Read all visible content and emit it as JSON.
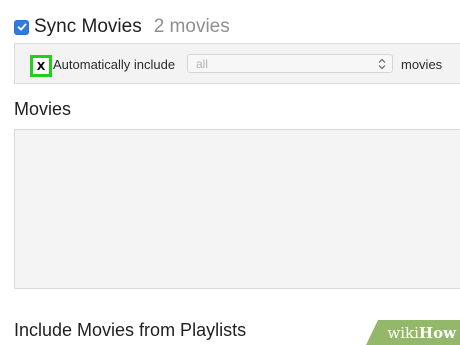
{
  "sync": {
    "label": "Sync Movies",
    "count": "2 movies",
    "checked": true
  },
  "auto_include": {
    "label": "Automatically include",
    "checkbox_mark": "X",
    "select_value": "all",
    "suffix": "movies"
  },
  "movies_section": {
    "title": "Movies"
  },
  "playlists_section": {
    "title": "Include Movies from Playlists"
  },
  "watermark": {
    "part1": "wiki",
    "part2": "How"
  },
  "colors": {
    "checkbox_blue": "#2f7ce0",
    "highlight_green": "#1fd11a",
    "wikihow_green": "#93b86a"
  }
}
